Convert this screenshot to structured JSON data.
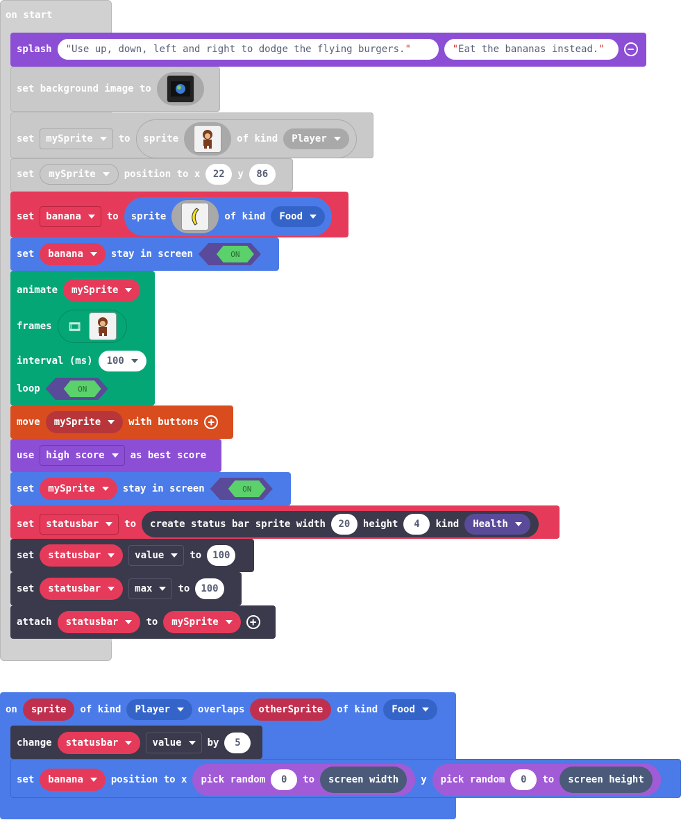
{
  "on_start": {
    "header": "on start",
    "splash": {
      "kw": "splash",
      "msg1": "Use up, down, left and right to dodge the flying burgers. ",
      "msg2": "Eat the bananas instead.",
      "remove_icon": "minus-circle-icon"
    },
    "bg": {
      "kw1": "set background image to",
      "image": "earth-image"
    },
    "s1": {
      "set": "set",
      "var": "mySprite",
      "to": "to",
      "sprite": "sprite",
      "ofkind": "of kind",
      "kind": "Player",
      "image": "monkey-image"
    },
    "s2": {
      "set": "set",
      "var": "mySprite",
      "pos": "position to x",
      "x": "22",
      "y": "y",
      "yv": "86"
    },
    "s3": {
      "set": "set",
      "var": "banana",
      "to": "to",
      "sprite": "sprite",
      "ofkind": "of kind",
      "kind": "Food",
      "image": "banana-image"
    },
    "s4": {
      "set": "set",
      "var": "banana",
      "stay": "stay in screen",
      "on": "ON"
    },
    "anim": {
      "animate": "animate",
      "var": "mySprite",
      "frames": "frames",
      "interval": "interval (ms)",
      "interval_v": "100",
      "loop": "loop",
      "on": "ON"
    },
    "move": {
      "move": "move",
      "var": "mySprite",
      "with": "with buttons",
      "add_icon": "plus-circle-icon"
    },
    "use": {
      "use": "use",
      "var": "high score",
      "as": "as best score"
    },
    "s5": {
      "set": "set",
      "var": "mySprite",
      "stay": "stay in screen",
      "on": "ON"
    },
    "s6": {
      "set": "set",
      "var": "statusbar",
      "to": "to",
      "create": "create status bar sprite width",
      "w": "20",
      "height": "height",
      "h": "4",
      "kind": "kind",
      "kindv": "Health"
    },
    "s7": {
      "set": "set",
      "var": "statusbar",
      "prop": "value",
      "to": "to",
      "v": "100"
    },
    "s8": {
      "set": "set",
      "var": "statusbar",
      "prop": "max",
      "to": "to",
      "v": "100"
    },
    "s9": {
      "attach": "attach",
      "var": "statusbar",
      "to": "to",
      "target": "mySprite",
      "add_icon": "plus-circle-icon"
    }
  },
  "overlap": {
    "on": "on",
    "sprite": "sprite",
    "ofkind": "of kind",
    "kind": "Player",
    "overlaps": "overlaps",
    "other": "otherSprite",
    "ofkind2": "of kind",
    "kind2": "Food",
    "c1": {
      "change": "change",
      "var": "statusbar",
      "prop": "value",
      "by": "by",
      "v": "5"
    },
    "c2": {
      "set": "set",
      "var": "banana",
      "pos": "position to x",
      "pick": "pick random",
      "zero": "0",
      "to": "to",
      "sw": "screen width",
      "y": "y",
      "pick2": "pick random",
      "zero2": "0",
      "to2": "to",
      "sh": "screen height"
    }
  },
  "colors": {
    "event_grey": "#d1d1d1",
    "scene": "#c9c9c9",
    "sprite_red": "#e63a5a",
    "sprite_blue": "#4b7be8",
    "anim_green": "#04a676",
    "ctrl_orange": "#d94c1e",
    "info_purple": "#8b4ed4",
    "status_dark": "#3a3a4c",
    "purple_pick": "#a25bd6"
  }
}
